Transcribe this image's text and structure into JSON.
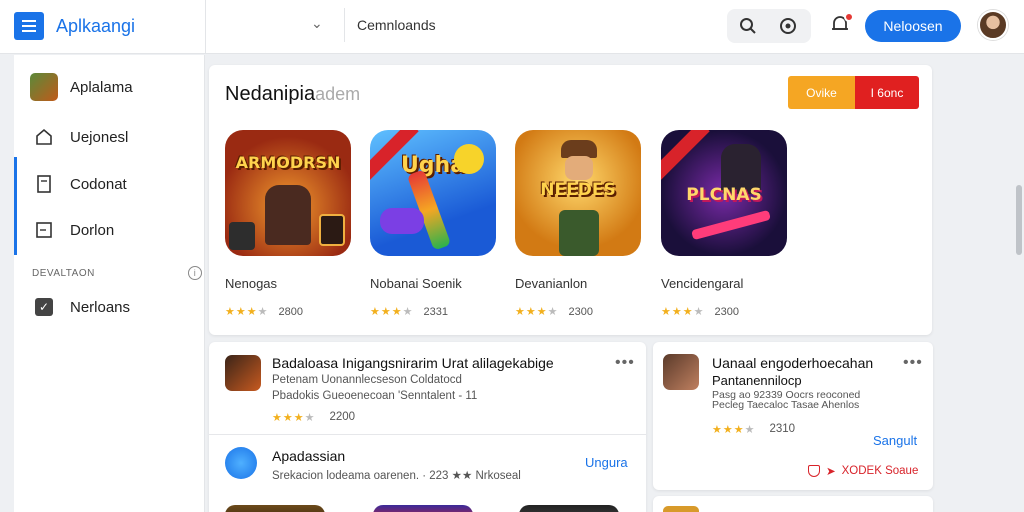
{
  "header": {
    "brand": "Aplkaangi",
    "search_value": "Cemnloands",
    "primary_button": "Neloosen"
  },
  "sidebar": {
    "items": [
      {
        "label": "Aplalama"
      },
      {
        "label": "Uejonesl"
      },
      {
        "label": "Codonat"
      },
      {
        "label": "Dorlon"
      }
    ],
    "section_label": "DEVALTAON",
    "section_items": [
      {
        "label": "Nerloans"
      }
    ]
  },
  "featured": {
    "title": "Nedanipia",
    "subtitle": "adem",
    "toggle_a": "Ovike",
    "toggle_b": "I 6onc",
    "games": [
      {
        "art_text": "ARMODRSN",
        "name": "Nenogas",
        "stars": 3,
        "count": "2800"
      },
      {
        "art_text": "Ugha",
        "name": "Nobanai Soenik",
        "stars": 3,
        "count": "2331"
      },
      {
        "art_text": "NEEDES",
        "name": "Devanianlon",
        "stars": 3,
        "count": "2300"
      },
      {
        "art_text": "PLCNAS",
        "name": "Vencidengaral",
        "stars": 3,
        "count": "2300"
      }
    ]
  },
  "list": {
    "rows": [
      {
        "title": "Badaloasa Inigangsnirarim Urat alilagekabige",
        "line2": "Petenam Uonannlecseson Coldatocd",
        "line3": "Pbadokis Gueoenecoan 'Senntalent - 11",
        "count": "2200",
        "more": "•••"
      },
      {
        "title": "Apadassian",
        "line2": "Srekacion lodeama oarenen. · 223 ★★ Nrkoseal",
        "link": "Ungura"
      }
    ]
  },
  "side_card": {
    "title": "Uanaal engoderhoecahan",
    "line2": "Pantanennilocp",
    "line3": "Pasg ao 92339 Oocrs reoconed",
    "line4": "Pecleg Taecaloc Tasae Ahenlos",
    "count": "2310",
    "link": "Sangult",
    "badge": "XODEK Soaue",
    "more": "•••"
  },
  "colors": {
    "accent": "#1a73e8",
    "orange": "#f5a623",
    "red": "#e02020",
    "star": "#f2b01e"
  }
}
